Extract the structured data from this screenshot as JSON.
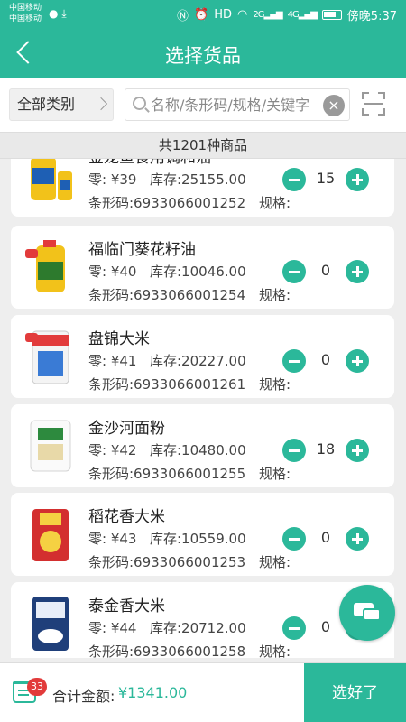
{
  "status_bar": {
    "carrier_1": "中国移动",
    "carrier_2": "中国移动",
    "signal_labels": [
      "2G",
      "4G"
    ],
    "time_text": "傍晚5:37"
  },
  "header": {
    "title": "选择货品",
    "back_icon": "chevron-left"
  },
  "filter": {
    "category_label": "全部类别",
    "search_placeholder": "名称/条形码/规格/关键字",
    "icons": [
      "search-icon",
      "clear-icon",
      "scan-icon"
    ]
  },
  "count_text": "共1201种商品",
  "products": [
    {
      "name": "金龙鱼食用调和油",
      "price_label": "零: ¥39",
      "stock_label": "库存:25155.00",
      "barcode_label": "条形码:6933066001252",
      "spec_label": "规格:",
      "qty": "15"
    },
    {
      "name": "福临门葵花籽油",
      "price_label": "零: ¥40",
      "stock_label": "库存:10046.00",
      "barcode_label": "条形码:6933066001254",
      "spec_label": "规格:",
      "qty": "0"
    },
    {
      "name": "盘锦大米",
      "price_label": "零: ¥41",
      "stock_label": "库存:20227.00",
      "barcode_label": "条形码:6933066001261",
      "spec_label": "规格:",
      "qty": "0"
    },
    {
      "name": "金沙河面粉",
      "price_label": "零: ¥42",
      "stock_label": "库存:10480.00",
      "barcode_label": "条形码:6933066001255",
      "spec_label": "规格:",
      "qty": "18"
    },
    {
      "name": "稻花香大米",
      "price_label": "零: ¥43",
      "stock_label": "库存:10559.00",
      "barcode_label": "条形码:6933066001253",
      "spec_label": "规格:",
      "qty": "0"
    },
    {
      "name": "泰金香大米",
      "price_label": "零: ¥44",
      "stock_label": "库存:20712.00",
      "barcode_label": "条形码:6933066001258",
      "spec_label": "规格:",
      "qty": "0"
    }
  ],
  "bottom": {
    "cart_badge": "33",
    "total_label": "合计金额:",
    "total_amount": "¥1341.00",
    "confirm_label": "选好了"
  },
  "colors": {
    "accent": "#2bb89a",
    "badge": "#e23b3b",
    "background": "#eeeeee"
  }
}
